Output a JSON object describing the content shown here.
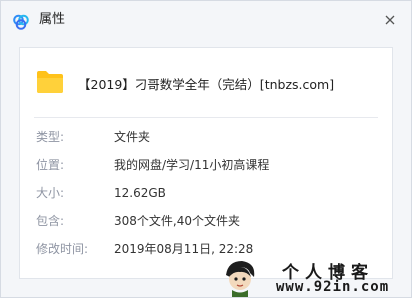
{
  "window": {
    "title": "属性",
    "app_icon": "properties-app-icon",
    "close_icon": "close-icon"
  },
  "item": {
    "icon": "folder-icon",
    "name": "【2019】刁哥数学全年（完结）[tnbzs.com]"
  },
  "properties": [
    {
      "label": "类型:",
      "value": "文件夹"
    },
    {
      "label": "位置:",
      "value": "我的网盘/学习/11小初高课程"
    },
    {
      "label": "大小:",
      "value": "12.62GB"
    },
    {
      "label": "包含:",
      "value": "308个文件,40个文件夹"
    },
    {
      "label": "修改时间:",
      "value": "2019年08月11日, 22:28"
    }
  ],
  "watermark": {
    "title": "个人博客",
    "url": "www.92in.com"
  },
  "colors": {
    "folder": "#ffc21a",
    "label": "#8f95a3",
    "value": "#333333"
  }
}
